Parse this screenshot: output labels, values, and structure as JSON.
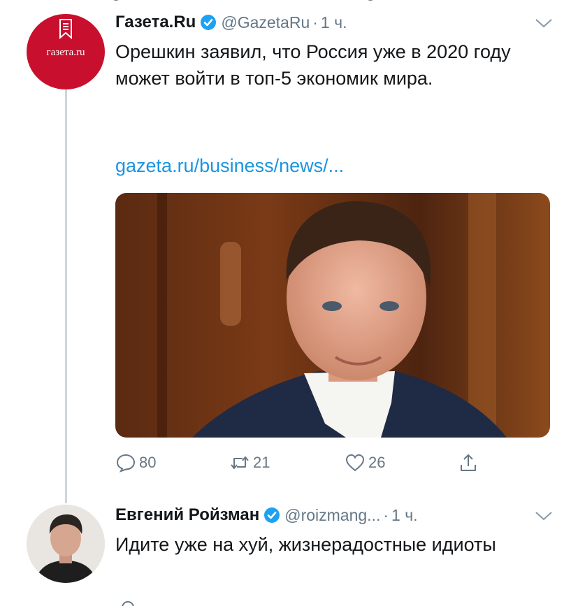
{
  "colors": {
    "accent": "#1b95e0",
    "muted": "#657786",
    "text": "#14171a",
    "line": "#ccd6dd",
    "gazeta_red": "#c8102e"
  },
  "tweet1": {
    "avatar_text": "газета.ru",
    "name": "Газета.Ru",
    "handle": "@GazetaRu",
    "separator": "·",
    "time": "1 ч.",
    "text": "Орешкин заявил, что Россия уже в 2020 году может войти в топ-5 экономик мира.",
    "link": "gazeta.ru/business/news/...",
    "media_alt": "photo",
    "actions": {
      "reply_count": "80",
      "retweet_count": "21",
      "like_count": "26"
    },
    "icons": [
      "verified-badge-icon",
      "chevron-down-icon",
      "reply-icon",
      "retweet-icon",
      "like-icon",
      "share-icon"
    ]
  },
  "tweet2": {
    "name": "Евгений Ройзман",
    "handle": "@roizmang...",
    "separator": "·",
    "time": "1 ч.",
    "text": "Идите уже на хуй, жизнерадостные идиоты",
    "icons": [
      "verified-badge-icon",
      "chevron-down-icon"
    ]
  }
}
